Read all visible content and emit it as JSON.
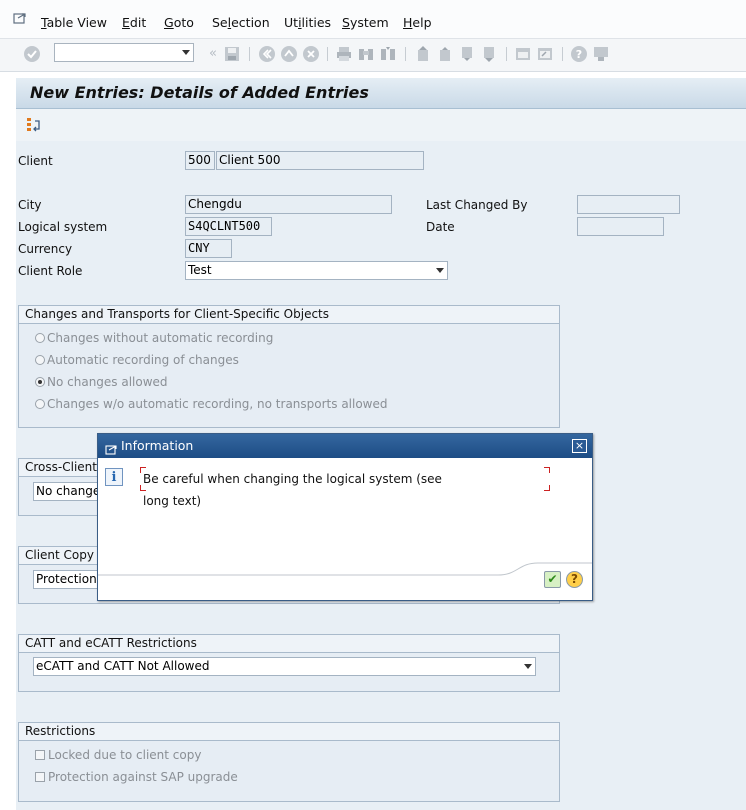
{
  "menu": {
    "items": [
      {
        "label": "Table View",
        "mnemonic": "T"
      },
      {
        "label": "Edit",
        "mnemonic": "E"
      },
      {
        "label": "Goto",
        "mnemonic": "G"
      },
      {
        "label": "Selection",
        "mnemonic": "l"
      },
      {
        "label": "Utilities",
        "mnemonic": "i"
      },
      {
        "label": "System",
        "mnemonic": "S"
      },
      {
        "label": "Help",
        "mnemonic": "H"
      }
    ]
  },
  "toolbar": {
    "command_field_value": "",
    "icons": [
      "enter-icon",
      "save-icon",
      "back-icon",
      "exit-icon",
      "cancel-icon",
      "print-icon",
      "find-icon",
      "find-next-icon",
      "first-page-icon",
      "previous-page-icon",
      "next-page-icon",
      "last-page-icon",
      "create-session-icon",
      "shortcut-icon",
      "help-icon",
      "layout-menu-icon"
    ]
  },
  "screen": {
    "title": "New Entries: Details of Added Entries"
  },
  "form": {
    "client_label": "Client",
    "client_number": "500",
    "client_name": "Client 500",
    "city_label": "City",
    "city_value": "Chengdu",
    "logical_system_label": "Logical system",
    "logical_system_value": "S4QCLNT500",
    "currency_label": "Currency",
    "currency_value": "CNY",
    "client_role_label": "Client Role",
    "client_role_value": "Test",
    "last_changed_by_label": "Last Changed By",
    "last_changed_by_value": "",
    "date_label": "Date",
    "date_value": ""
  },
  "groups": {
    "changes": {
      "title": "Changes and Transports for Client-Specific Objects",
      "options": [
        {
          "label": "Changes without automatic recording",
          "selected": false
        },
        {
          "label": "Automatic recording of changes",
          "selected": false
        },
        {
          "label": "No changes allowed",
          "selected": true
        },
        {
          "label": "Changes w/o automatic recording, no transports allowed",
          "selected": false
        }
      ]
    },
    "cross_client": {
      "title": "Cross-Client C",
      "value": "No changes"
    },
    "client_copy": {
      "title": "Client Copy a",
      "value": "Protection"
    },
    "catt": {
      "title": "CATT and eCATT Restrictions",
      "value": "eCATT and CATT Not Allowed"
    },
    "restrictions": {
      "title": "Restrictions",
      "options": [
        {
          "label": "Locked due to client copy",
          "checked": false
        },
        {
          "label": "Protection against SAP upgrade",
          "checked": false
        }
      ]
    }
  },
  "dialog": {
    "title": "Information",
    "message_line1": "Be careful when changing the logical system (see",
    "message_line2": "long text)",
    "close_symbol": "×",
    "ok_symbol": "✔",
    "help_symbol": "?"
  },
  "colors": {
    "dialog_title_bg": "#1d4c85",
    "content_bg": "#e8eff5",
    "accent_red": "#cc2222"
  }
}
